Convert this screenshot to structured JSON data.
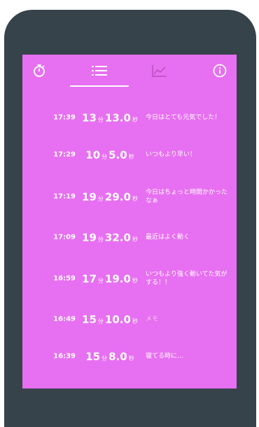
{
  "tabs": {
    "stopwatch": "stopwatch-icon",
    "list": "list-icon",
    "chart": "chart-icon",
    "info": "info-icon",
    "active": "list"
  },
  "colors": {
    "device": "#37434b",
    "screen": "#e76ff1",
    "text": "#ffffff"
  },
  "records": [
    {
      "time": "17:39",
      "min": "13",
      "min_unit": "分",
      "sec": "13.0",
      "sec_unit": "秒",
      "memo": "今日はとても元気でした！"
    },
    {
      "time": "17:29",
      "min": "10",
      "min_unit": "分",
      "sec": "5.0",
      "sec_unit": "秒",
      "memo": "いつもより早い！"
    },
    {
      "time": "17:19",
      "min": "19",
      "min_unit": "分",
      "sec": "29.0",
      "sec_unit": "秒",
      "memo": "今日はちょっと時間かかったなぁ"
    },
    {
      "time": "17:09",
      "min": "19",
      "min_unit": "分",
      "sec": "32.0",
      "sec_unit": "秒",
      "memo": "最近はよく動く"
    },
    {
      "time": "16:59",
      "min": "17",
      "min_unit": "分",
      "sec": "19.0",
      "sec_unit": "秒",
      "memo": "いつもより強く動いてた気がする！！"
    },
    {
      "time": "16:49",
      "min": "15",
      "min_unit": "分",
      "sec": "10.0",
      "sec_unit": "秒",
      "memo": "メモ"
    },
    {
      "time": "16:39",
      "min": "15",
      "min_unit": "分",
      "sec": "8.0",
      "sec_unit": "秒",
      "memo": "寝てる時に…"
    }
  ]
}
